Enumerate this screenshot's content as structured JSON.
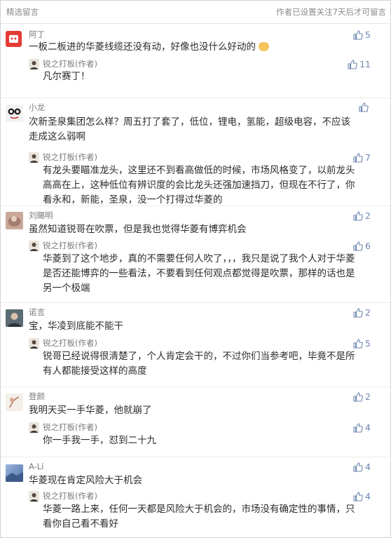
{
  "header": {
    "title": "精选留言",
    "notice": "作者已设置关注7天后才可留言"
  },
  "comments": [
    {
      "name": "阿丁",
      "text": "一板二板进的华菱线缆还没有动，好像也没什么好动的",
      "likes": "5",
      "reply": {
        "name": "锐之打板(作者)",
        "text": "凡尔赛丁！",
        "likes": "11"
      }
    },
    {
      "name": "小龙",
      "text": "次新圣泉集团怎么样？周五打了套了，低位，锂电，氢能，超级电容，不应该走成这么弱啊",
      "likes": "",
      "reply": {
        "name": "锐之打板(作者)",
        "text": "有龙头要瞄准龙头，这里还不到看高做低的时候，市场风格变了，以前龙头高高在上，这种低位有辨识度的会比龙头还强加速挡刀，但现在不行了，你看永和，新能，圣泉，没一个打得过华菱的",
        "likes": "7"
      }
    },
    {
      "name": "刘颺明",
      "text": "虽然知道锐哥在吹票，但是我也觉得华菱有博弈机会",
      "likes": "2",
      "reply": {
        "name": "锐之打板(作者)",
        "text": "华菱到了这个地步，真的不需要任何人吹了，，，我只是说了我个人对于华菱是否还能博弈的一些看法，不要看到任何观点都觉得是吹票，那样的话也是另一个极端",
        "likes": "6"
      }
    },
    {
      "name": "诺言",
      "text": "宝，华凌到底能不能干",
      "likes": "2",
      "reply": {
        "name": "锐之打板(作者)",
        "text": "锐哥已经说得很清楚了，个人肯定会干的，不过你们当参考吧，毕竟不是所有人都能接受这样的高度",
        "likes": "5"
      }
    },
    {
      "name": "登颜",
      "text": "我明天买一手华菱，他就崩了",
      "likes": "2",
      "reply": {
        "name": "锐之打板(作者)",
        "text": "你一手我一手，怼到二十九",
        "likes": "4"
      }
    },
    {
      "name": "A-Li",
      "text": "华菱现在肯定风险大于机会",
      "likes": "4",
      "reply": {
        "name": "锐之打板(作者)",
        "text": "华菱一路上来，任何一天都是风险大于机会的，市场没有确定性的事情，只看你自己看不看好",
        "likes": "4"
      }
    }
  ],
  "colors": {
    "accent": "#6c86b0",
    "muted": "#8a8a8a"
  }
}
